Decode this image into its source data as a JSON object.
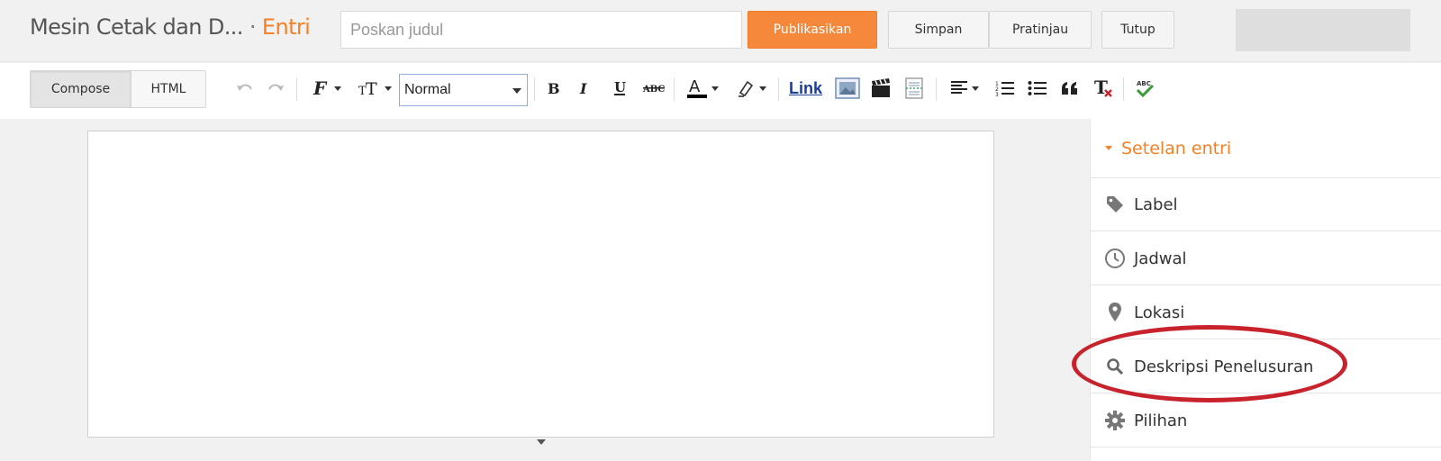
{
  "header": {
    "blog_title": "Mesin Cetak dan D...",
    "separator": "·",
    "section": "Entri",
    "title_placeholder": "Poskan judul",
    "publish_label": "Publikasikan",
    "save_label": "Simpan",
    "preview_label": "Pratinjau",
    "close_label": "Tutup"
  },
  "toolbar": {
    "compose_label": "Compose",
    "html_label": "HTML",
    "format_value": "Normal",
    "link_label": "Link",
    "icons": [
      "undo-icon",
      "redo-icon",
      "font-family-icon",
      "font-size-icon",
      "bold-icon",
      "italic-icon",
      "underline-icon",
      "strikethrough-icon",
      "text-color-icon",
      "highlight-color-icon",
      "link",
      "image-icon",
      "video-icon",
      "jump-break-icon",
      "align-icon",
      "numbered-list-icon",
      "bulleted-list-icon",
      "quote-icon",
      "remove-format-icon",
      "spell-check-icon"
    ]
  },
  "sidebar": {
    "header": "Setelan entri",
    "items": [
      {
        "label": "Label",
        "icon": "tag-icon"
      },
      {
        "label": "Jadwal",
        "icon": "clock-icon"
      },
      {
        "label": "Lokasi",
        "icon": "location-pin-icon"
      },
      {
        "label": "Deskripsi Penelusuran",
        "icon": "search-icon"
      },
      {
        "label": "Pilihan",
        "icon": "gear-icon"
      }
    ]
  },
  "colors": {
    "accent": "#f58025",
    "publish_button": "#f5883a",
    "highlight_ring": "#c8232c",
    "link": "#1a3c9a"
  }
}
